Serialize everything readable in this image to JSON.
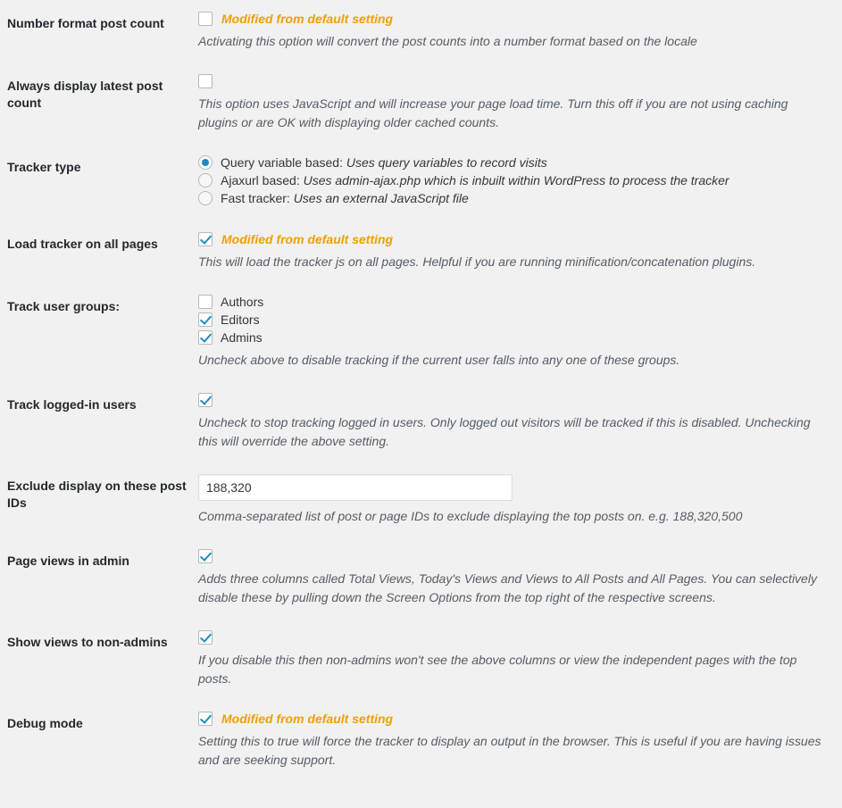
{
  "colors": {
    "background": "#f1f1f1",
    "label_text": "#23282d",
    "description_text": "#555d66",
    "modified_notice": "#f0a000",
    "control_accent": "#1e8cbe",
    "input_border": "#ddd"
  },
  "modified_notice_text": "Modified from default setting",
  "settings": [
    {
      "id": "number-format-post-count",
      "label": "Number format post count",
      "control": "checkbox",
      "checked": false,
      "modified": true,
      "description": "Activating this option will convert the post counts into a number format based on the locale"
    },
    {
      "id": "always-display-latest-post-count",
      "label": "Always display latest post count",
      "control": "checkbox",
      "checked": false,
      "modified": false,
      "description": "This option uses JavaScript and will increase your page load time. Turn this off if you are not using caching plugins or are OK with displaying older cached counts."
    },
    {
      "id": "tracker-type",
      "label": "Tracker type",
      "control": "radio-group",
      "options": [
        {
          "id": "query-variable-based",
          "name": "Query variable based:",
          "detail": "Uses query variables to record visits",
          "selected": true
        },
        {
          "id": "ajaxurl-based",
          "name": "Ajaxurl based:",
          "detail": "Uses admin-ajax.php which is inbuilt within WordPress to process the tracker",
          "selected": false
        },
        {
          "id": "fast-tracker",
          "name": "Fast tracker:",
          "detail": "Uses an external JavaScript file",
          "selected": false
        }
      ],
      "description": ""
    },
    {
      "id": "load-tracker-on-all-pages",
      "label": "Load tracker on all pages",
      "control": "checkbox",
      "checked": true,
      "modified": true,
      "description": "This will load the tracker js on all pages. Helpful if you are running minification/concatenation plugins."
    },
    {
      "id": "track-user-groups",
      "label": "Track user groups:",
      "control": "checkbox-group",
      "options": [
        {
          "id": "authors",
          "name": "Authors",
          "checked": false
        },
        {
          "id": "editors",
          "name": "Editors",
          "checked": true
        },
        {
          "id": "admins",
          "name": "Admins",
          "checked": true
        }
      ],
      "description": "Uncheck above to disable tracking if the current user falls into any one of these groups."
    },
    {
      "id": "track-logged-in-users",
      "label": "Track logged-in users",
      "control": "checkbox",
      "checked": true,
      "modified": false,
      "description": "Uncheck to stop tracking logged in users. Only logged out visitors will be tracked if this is disabled. Unchecking this will override the above setting."
    },
    {
      "id": "exclude-display-on-these-post-ids",
      "label": "Exclude display on these post IDs",
      "control": "text",
      "value": "188,320",
      "placeholder": "",
      "description": "Comma-separated list of post or page IDs to exclude displaying the top posts on. e.g. 188,320,500"
    },
    {
      "id": "page-views-in-admin",
      "label": "Page views in admin",
      "control": "checkbox",
      "checked": true,
      "modified": false,
      "description": "Adds three columns called Total Views, Today's Views and Views to All Posts and All Pages. You can selectively disable these by pulling down the Screen Options from the top right of the respective screens."
    },
    {
      "id": "show-views-to-non-admins",
      "label": "Show views to non-admins",
      "control": "checkbox",
      "checked": true,
      "modified": false,
      "description": "If you disable this then non-admins won't see the above columns or view the independent pages with the top posts."
    },
    {
      "id": "debug-mode",
      "label": "Debug mode",
      "control": "checkbox",
      "checked": true,
      "modified": true,
      "description": "Setting this to true will force the tracker to display an output in the browser. This is useful if you are having issues and are seeking support."
    }
  ]
}
